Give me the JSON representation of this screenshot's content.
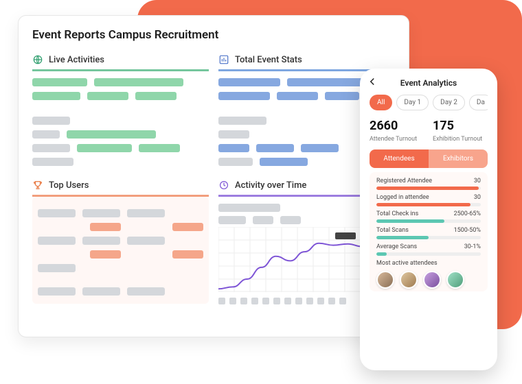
{
  "dashboard": {
    "title": "Event Reports Campus Recruitment",
    "panels": {
      "live": {
        "label": "Live Activities"
      },
      "totals": {
        "label": "Total Event Stats"
      },
      "topUsers": {
        "label": "Top Users"
      },
      "activity": {
        "label": "Activity over Time"
      }
    }
  },
  "phone": {
    "title": "Event Analytics",
    "filters": [
      "All",
      "Day 1",
      "Day 2",
      "Da"
    ],
    "activeFilter": "All",
    "stats": [
      {
        "value": "2660",
        "label": "Attendee Turnout"
      },
      {
        "value": "175",
        "label": "Exhibition Turnout"
      }
    ],
    "seg": {
      "a": "Attendees",
      "b": "Exhibitors",
      "active": "a"
    },
    "metrics": [
      {
        "label": "Registered Attendee",
        "value": "30",
        "pct": 98,
        "color": "#F26A4B"
      },
      {
        "label": "Logged in attendee",
        "value": "30",
        "pct": 90,
        "color": "#F26A4B"
      },
      {
        "label": "Total Check ins",
        "value": "2500-65%",
        "pct": 65,
        "color": "#5CC7B2"
      },
      {
        "label": "Total Scans",
        "value": "1500-50%",
        "pct": 50,
        "color": "#5CC7B2"
      },
      {
        "label": "Average Scans",
        "value": "30-1%",
        "pct": 10,
        "color": "#5CC7B2"
      }
    ],
    "activeHeader": "Most active attendees"
  },
  "colors": {
    "accent": "#F26A4B",
    "green": "#8FD6AA",
    "blue": "#86A8E0",
    "purple": "#9D7DE0",
    "orange": "#F5A68A",
    "grey": "#D4D7DB"
  },
  "chart_data": {
    "type": "line",
    "title": "Activity over Time",
    "xlabel": "",
    "ylabel": "",
    "x": [
      1,
      2,
      3,
      4,
      5,
      6,
      7,
      8,
      9,
      10,
      11,
      12
    ],
    "values": [
      5,
      8,
      20,
      38,
      55,
      48,
      62,
      75,
      72,
      74,
      70,
      66
    ],
    "ylim": [
      0,
      100
    ]
  }
}
